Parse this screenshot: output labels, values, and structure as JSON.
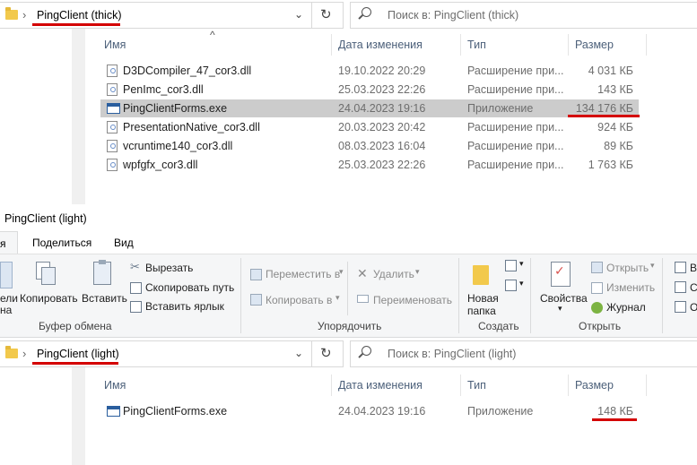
{
  "top_window": {
    "address": {
      "path": "PingClient (thick)",
      "chevron": "›",
      "dropdown": "⌄",
      "refresh": "↻"
    },
    "search_placeholder": "Поиск в: PingClient (thick)",
    "columns": {
      "name": "Имя",
      "date": "Дата изменения",
      "type": "Тип",
      "size": "Размер"
    },
    "sort_arrow": "^",
    "files": [
      {
        "name": "D3DCompiler_47_cor3.dll",
        "date": "19.10.2022 20:29",
        "type": "Расширение при...",
        "size": "4 031 КБ"
      },
      {
        "name": "PenImc_cor3.dll",
        "date": "25.03.2023 22:26",
        "type": "Расширение при...",
        "size": "143 КБ"
      },
      {
        "name": "PingClientForms.exe",
        "date": "24.04.2023 19:16",
        "type": "Приложение",
        "size": "134 176 КБ"
      },
      {
        "name": "PresentationNative_cor3.dll",
        "date": "20.03.2023 20:42",
        "type": "Расширение при...",
        "size": "924 КБ"
      },
      {
        "name": "vcruntime140_cor3.dll",
        "date": "08.03.2023 16:04",
        "type": "Расширение при...",
        "size": "89 КБ"
      },
      {
        "name": "wpfgfx_cor3.dll",
        "date": "25.03.2023 22:26",
        "type": "Расширение при...",
        "size": "1 763 КБ"
      }
    ]
  },
  "bottom_window": {
    "title": "PingClient (light)",
    "tabs": {
      "home": "я",
      "share": "Поделиться",
      "view": "Вид"
    },
    "ribbon": {
      "clipboard": {
        "pin_label_1": "ели",
        "pin_label_2": "на",
        "copy": "Копировать",
        "paste": "Вставить",
        "cut": "Вырезать",
        "copy_path": "Скопировать путь",
        "paste_shortcut": "Вставить ярлык",
        "group": "Буфер обмена"
      },
      "organize": {
        "move_to": "Переместить в",
        "copy_to": "Копировать в",
        "delete": "Удалить",
        "rename": "Переименовать",
        "group": "Упорядочить"
      },
      "create": {
        "new_folder_1": "Новая",
        "new_folder_2": "папка",
        "group": "Создать"
      },
      "open": {
        "properties": "Свойства",
        "open": "Открыть",
        "edit": "Изменить",
        "history": "Журнал",
        "group": "Открыть"
      },
      "select": {
        "l1": "Вы",
        "l2": "Сн",
        "l3": "Об"
      }
    },
    "address": {
      "path": "PingClient (light)",
      "chevron": "›",
      "dropdown": "⌄",
      "refresh": "↻"
    },
    "search_placeholder": "Поиск в: PingClient (light)",
    "columns": {
      "name": "Имя",
      "date": "Дата изменения",
      "type": "Тип",
      "size": "Размер"
    },
    "files": [
      {
        "name": "PingClientForms.exe",
        "date": "24.04.2023 19:16",
        "type": "Приложение",
        "size": "148 КБ"
      }
    ]
  },
  "colors": {
    "highlight_underline": "#d40000",
    "selection": "#cccccc",
    "header_text": "#4c607a"
  }
}
